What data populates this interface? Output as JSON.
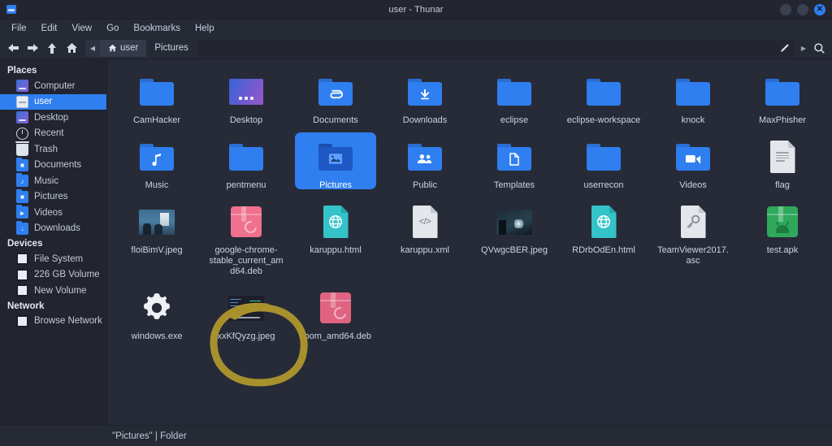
{
  "window": {
    "title": "user - Thunar",
    "app_icon": "folder-icon",
    "controls": [
      {
        "name": "minimize-button",
        "glyph": ""
      },
      {
        "name": "maximize-button",
        "glyph": ""
      },
      {
        "name": "close-button",
        "glyph": "✕"
      }
    ]
  },
  "menubar": {
    "items": [
      {
        "label": "File"
      },
      {
        "label": "Edit"
      },
      {
        "label": "View"
      },
      {
        "label": "Go"
      },
      {
        "label": "Bookmarks"
      },
      {
        "label": "Help"
      }
    ]
  },
  "toolbar": {
    "back_icon": "arrow-left-icon",
    "forward_icon": "arrow-right-icon",
    "up_icon": "arrow-up-icon",
    "home_icon": "home-icon",
    "scroll_left_icon": "chevron-left-icon",
    "edit_path_icon": "pencil-icon",
    "overflow_icon": "chevron-right-icon",
    "search_icon": "search-icon",
    "breadcrumbs": [
      {
        "label": "user",
        "active": true,
        "icon": "home-icon"
      },
      {
        "label": "Pictures",
        "active": false,
        "icon": ""
      }
    ]
  },
  "sidebar": {
    "sections": [
      {
        "heading": "Places",
        "items": [
          {
            "label": "Computer",
            "icon": "computer-icon",
            "selected": false
          },
          {
            "label": "user",
            "icon": "home-icon",
            "selected": true
          },
          {
            "label": "Desktop",
            "icon": "desktop-icon",
            "selected": false
          },
          {
            "label": "Recent",
            "icon": "recent-icon",
            "selected": false
          },
          {
            "label": "Trash",
            "icon": "trash-icon",
            "selected": false
          },
          {
            "label": "Documents",
            "icon": "documents-folder-icon",
            "selected": false
          },
          {
            "label": "Music",
            "icon": "music-folder-icon",
            "selected": false
          },
          {
            "label": "Pictures",
            "icon": "pictures-folder-icon",
            "selected": false
          },
          {
            "label": "Videos",
            "icon": "videos-folder-icon",
            "selected": false
          },
          {
            "label": "Downloads",
            "icon": "downloads-folder-icon",
            "selected": false
          }
        ]
      },
      {
        "heading": "Devices",
        "items": [
          {
            "label": "File System",
            "icon": "disk-icon",
            "selected": false
          },
          {
            "label": "226 GB Volume",
            "icon": "disk-icon",
            "selected": false
          },
          {
            "label": "New Volume",
            "icon": "disk-icon",
            "selected": false
          }
        ]
      },
      {
        "heading": "Network",
        "items": [
          {
            "label": "Browse Network",
            "icon": "network-icon",
            "selected": false
          }
        ]
      }
    ]
  },
  "files": [
    {
      "label": "CamHacker",
      "type": "folder",
      "glyph": "",
      "selected": false
    },
    {
      "label": "Desktop",
      "type": "desktop",
      "glyph": "",
      "selected": false
    },
    {
      "label": "Documents",
      "type": "folder",
      "glyph": "📎",
      "selected": false
    },
    {
      "label": "Downloads",
      "type": "folder",
      "glyph": "download",
      "selected": false
    },
    {
      "label": "eclipse",
      "type": "folder",
      "glyph": "",
      "selected": false
    },
    {
      "label": "eclipse-workspace",
      "type": "folder",
      "glyph": "",
      "selected": false
    },
    {
      "label": "knock",
      "type": "folder",
      "glyph": "",
      "selected": false
    },
    {
      "label": "MaxPhisher",
      "type": "folder",
      "glyph": "",
      "selected": false
    },
    {
      "label": "Music",
      "type": "folder",
      "glyph": "♪",
      "selected": false
    },
    {
      "label": "pentmenu",
      "type": "folder",
      "glyph": "",
      "selected": false
    },
    {
      "label": "Pictures",
      "type": "folder",
      "glyph": "image",
      "selected": true
    },
    {
      "label": "Public",
      "type": "folder",
      "glyph": "people",
      "selected": false
    },
    {
      "label": "Templates",
      "type": "folder",
      "glyph": "template",
      "selected": false
    },
    {
      "label": "userrecon",
      "type": "folder",
      "glyph": "",
      "selected": false
    },
    {
      "label": "Videos",
      "type": "folder",
      "glyph": "video",
      "selected": false
    },
    {
      "label": "flag",
      "type": "doc-text",
      "glyph": "",
      "selected": false
    },
    {
      "label": "floiBimV.jpeg",
      "type": "thumb-room",
      "glyph": "",
      "selected": false
    },
    {
      "label": "google-chrome-stable_current_amd64.deb",
      "type": "deb",
      "glyph": "",
      "selected": false
    },
    {
      "label": "karuppu.html",
      "type": "doc-html",
      "glyph": "",
      "selected": false
    },
    {
      "label": "karuppu.xml",
      "type": "doc-code",
      "glyph": "</>",
      "selected": false
    },
    {
      "label": "QVwgcBER.jpeg",
      "type": "thumb-dark",
      "glyph": "",
      "selected": false
    },
    {
      "label": "RDrbOdEn.html",
      "type": "doc-html",
      "glyph": "",
      "selected": false
    },
    {
      "label": "TeamViewer2017.asc",
      "type": "doc-key",
      "glyph": "",
      "selected": false
    },
    {
      "label": "test.apk",
      "type": "apk",
      "glyph": "",
      "selected": false
    },
    {
      "label": "windows.exe",
      "type": "gear",
      "glyph": "",
      "selected": false
    },
    {
      "label": "xxKfQyzg.jpeg",
      "type": "thumb-term",
      "glyph": "",
      "selected": false
    },
    {
      "label": "zoom_amd64.deb",
      "type": "deb-dark",
      "glyph": "",
      "selected": false
    }
  ],
  "annotation": {
    "name": "highlight-circle",
    "target": "windows.exe",
    "color": "#a8912d"
  },
  "statusbar": {
    "text": "\"Pictures\" | Folder"
  },
  "colors": {
    "accent": "#2f7ff0",
    "window_bg": "#272b38",
    "sidebar_bg": "#22252f",
    "chrome_bg": "#262a35",
    "annotation": "#a8912d"
  }
}
